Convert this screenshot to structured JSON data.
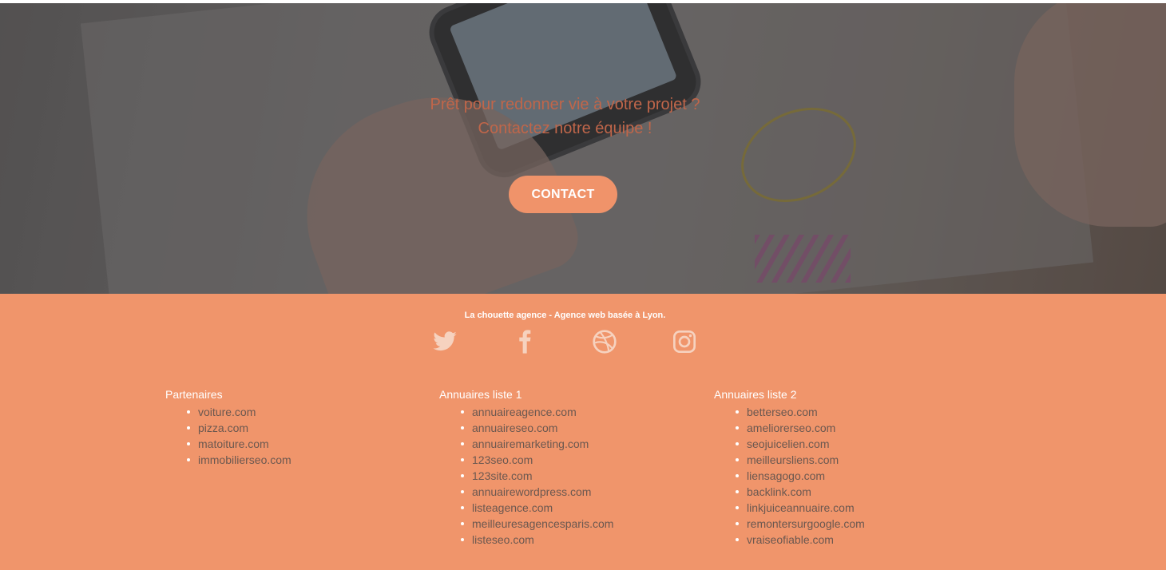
{
  "hero": {
    "line1": "Prêt pour redonner vie à votre projet ?",
    "line2": "Contactez notre équipe !",
    "contact_label": "CONTACT"
  },
  "footer": {
    "tagline": "La chouette agence - Agence web basée à Lyon.",
    "social_icons": [
      "twitter-icon",
      "facebook-icon",
      "dribbble-icon",
      "instagram-icon"
    ],
    "columns": [
      {
        "title": "Partenaires",
        "items": [
          "voiture.com",
          "pizza.com",
          "matoiture.com",
          "immobilierseo.com"
        ]
      },
      {
        "title": "Annuaires liste 1",
        "items": [
          "annuaireagence.com",
          "annuaireseo.com",
          "annuairemarketing.com",
          "123seo.com",
          "123site.com",
          "annuairewordpress.com",
          "listeagence.com",
          "meilleuresagencesparis.com",
          "listeseo.com"
        ]
      },
      {
        "title": "Annuaires liste 2",
        "items": [
          "betterseo.com",
          "ameliorerseo.com",
          "seojuicelien.com",
          "meilleursliens.com",
          "liensagogo.com",
          "backlink.com",
          "linkjuiceannuaire.com",
          "remontersurgoogle.com",
          "vraiseofiable.com"
        ]
      }
    ]
  },
  "colors": {
    "accent": "#f0956b",
    "hero_text": "#c0664a",
    "link_text": "#6b5850"
  }
}
